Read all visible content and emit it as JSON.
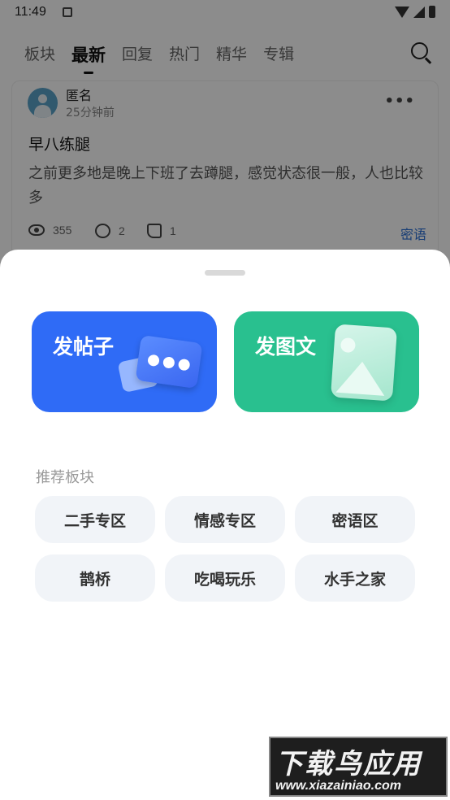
{
  "status_bar": {
    "time": "11:49"
  },
  "nav": {
    "tabs": [
      {
        "label": "板块",
        "active": false
      },
      {
        "label": "最新",
        "active": true
      },
      {
        "label": "回复",
        "active": false
      },
      {
        "label": "热门",
        "active": false
      },
      {
        "label": "精华",
        "active": false
      },
      {
        "label": "专辑",
        "active": false
      }
    ],
    "search_icon": "search-icon"
  },
  "post": {
    "author": "匿名",
    "time": "25分钟前",
    "more": "•••",
    "title": "早八练腿",
    "body": "之前更多地是晚上下班了去蹲腿，感觉状态很一般，人也比较多",
    "views": "355",
    "comments": "2",
    "likes": "1",
    "tag": "密语"
  },
  "sheet": {
    "actions": [
      {
        "label": "发帖子",
        "color": "#2f6bf6"
      },
      {
        "label": "发图文",
        "color": "#29c08f"
      }
    ],
    "section_title": "推荐板块",
    "boards": [
      "二手专区",
      "情感专区",
      "密语区",
      "鹊桥",
      "吃喝玩乐",
      "水手之家"
    ]
  },
  "watermark": {
    "main": "下载鸟应用",
    "url": "www.xiazainiao.com"
  }
}
